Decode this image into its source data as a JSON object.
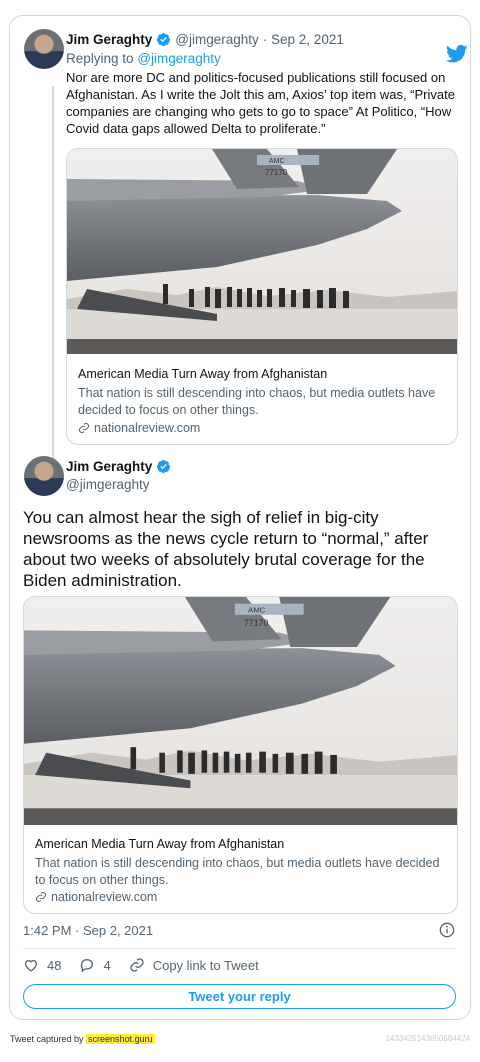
{
  "tweet1": {
    "name": "Jim Geraghty",
    "handle": "@jimgeraghty",
    "date": "· Sep 2, 2021",
    "replying_prefix": "Replying to",
    "replying_handle": "@jimgeraghty",
    "text": "Nor are more DC and politics-focused publications still focused on Afghanistan. As I write the Jolt this am, Axios’ top item was, “Private companies are changing who gets to go to space” At Politico, “How Covid data gaps allowed Delta to proliferate.”",
    "card": {
      "title": "American Media Turn Away from Afghanistan",
      "description": "That nation is still descending into chaos, but media outlets have decided to focus on other things.",
      "domain": "nationalreview.com"
    }
  },
  "tweet2": {
    "name": "Jim Geraghty",
    "handle": "@jimgeraghty",
    "text": "You can almost hear the sigh of relief in big-city newsrooms as the news cycle return to “normal,” after about two weeks of absolutely brutal coverage for the Biden administration.",
    "card": {
      "title": "American Media Turn Away from Afghanistan",
      "description": "That nation is still descending into chaos, but media outlets have decided to focus on other things.",
      "domain": "nationalreview.com"
    },
    "timestamp": "1:42 PM · Sep 2, 2021",
    "likes": "48",
    "replies": "4",
    "copy_link": "Copy link to Tweet",
    "reply_button": "Tweet your reply"
  },
  "plane_markings": {
    "tail_code": "AMC",
    "tail_number": "77170"
  },
  "footer": {
    "captured_by": "Tweet captured by ",
    "brand": "screenshot.guru",
    "id": "1433425143850684424"
  },
  "colors": {
    "accent": "#1d9bf0",
    "text": "#0f1419",
    "muted": "#536471",
    "border": "#cfd9de"
  },
  "icons": [
    "twitter-bird-icon",
    "verified-badge-icon",
    "link-icon",
    "info-icon",
    "heart-icon",
    "reply-bubble-icon",
    "copy-link-icon"
  ]
}
